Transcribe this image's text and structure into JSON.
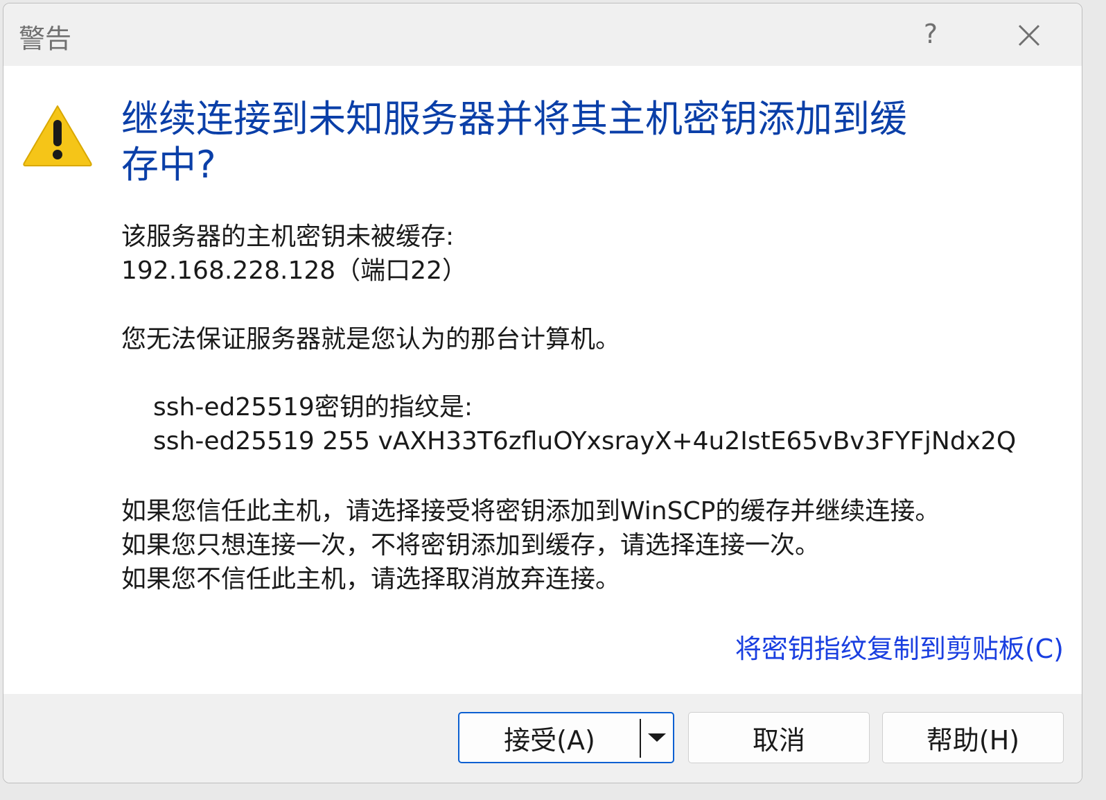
{
  "window": {
    "title": "警告",
    "help_glyph": "?",
    "close_icon": "close-icon"
  },
  "icon": "warning-triangle-icon",
  "headline": "继续连接到未知服务器并将其主机密钥添加到缓存中?",
  "message": {
    "line1": "该服务器的主机密钥未被缓存:",
    "line2": "192.168.228.128（端口22）",
    "line3": "您无法保证服务器就是您认为的那台计算机。",
    "fingerprint_label": "ssh-ed25519密钥的指纹是:",
    "fingerprint_value": "ssh-ed25519 255 vAXH33T6zfluOYxsrayX+4u2IstE65vBv3FYFjNdx2Q",
    "instr1": "如果您信任此主机，请选择接受将密钥添加到WinSCP的缓存并继续连接。",
    "instr2": "如果您只想连接一次，不将密钥添加到缓存，请选择连接一次。",
    "instr3": "如果您不信任此主机，请选择取消放弃连接。"
  },
  "copy_link": "将密钥指纹复制到剪贴板(C)",
  "buttons": {
    "accept": "接受(A)",
    "cancel": "取消",
    "help": "帮助(H)"
  },
  "colors": {
    "headline": "#0a3fa8",
    "link": "#1a3fe0",
    "accent": "#0b5fd1",
    "warning": "#f5c518"
  }
}
